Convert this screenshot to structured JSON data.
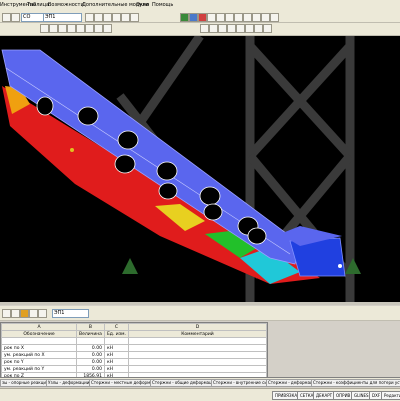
{
  "menu": [
    "Инструменты",
    "Таблица",
    "Возможности",
    "Дополнительные модули",
    "Окно",
    "Помощь"
  ],
  "toolbar": {
    "case_combo": "СО",
    "case_combo2": "ЭП1"
  },
  "results_table": {
    "headers": [
      "A",
      "B",
      "C",
      "D"
    ],
    "subheaders": [
      "Обозначение",
      "Величина",
      "Ед. изм.",
      "Комментарий"
    ],
    "rows": [
      [
        "",
        "",
        "",
        ""
      ],
      [
        "рок по X",
        "0.00",
        "кН",
        ""
      ],
      [
        "ум. реакций по X",
        "0.00",
        "кН",
        ""
      ],
      [
        "рок по Y",
        "0.00",
        "кН",
        ""
      ],
      [
        "ум. реакций по Y",
        "0.00",
        "кН",
        ""
      ],
      [
        "рок по Z",
        "1856.91",
        "кН",
        ""
      ]
    ]
  },
  "tabs": [
    "зы - опорные реакции",
    "Узлы - деформации",
    "Стержни - местные деформации",
    "Стержни - общие деформации",
    "Стержни - внутренние силы",
    "Стержни - деформации",
    "Стержни - коэффициенты для потери устойчивости"
  ],
  "status_buttons": [
    "ПРИВЯЗКА",
    "СЕТКА",
    "ДЕКАРТ",
    "ОПРИВ",
    "GLINES",
    "DXF",
    "Редактирова"
  ],
  "colors": {
    "background": "#000000",
    "beam_top": "#5a66ee",
    "red": "#e01c1c",
    "orange": "#f0a010",
    "green": "#22c02a"
  }
}
